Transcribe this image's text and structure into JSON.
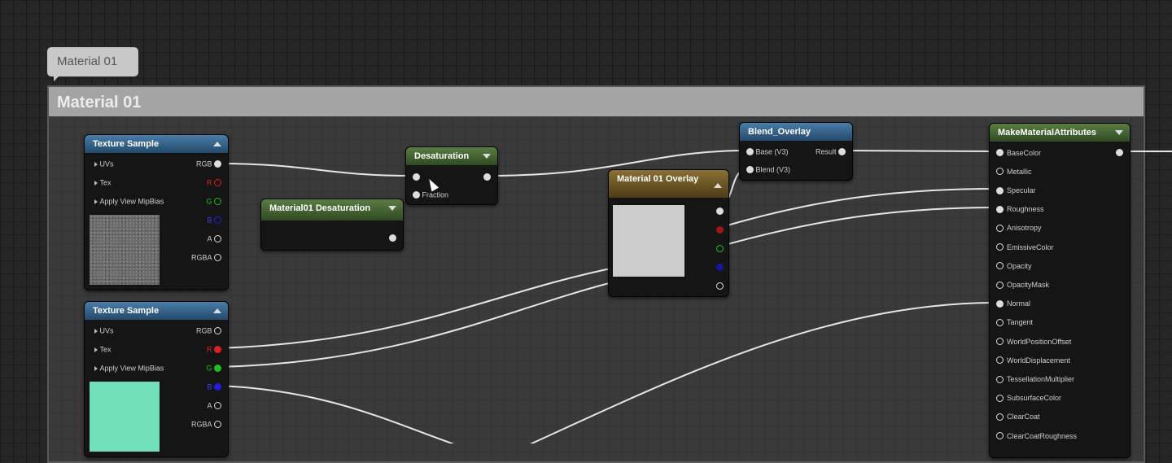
{
  "tooltip": {
    "text": "Material 01"
  },
  "comment": {
    "title": "Material 01"
  },
  "nodes": {
    "tex1": {
      "title": "Texture Sample",
      "inputs": [
        "UVs",
        "Tex",
        "Apply View MipBias"
      ],
      "outputs": [
        "RGB",
        "R",
        "G",
        "B",
        "A",
        "RGBA"
      ]
    },
    "tex2": {
      "title": "Texture Sample",
      "inputs": [
        "UVs",
        "Tex",
        "Apply View MipBias"
      ],
      "outputs": [
        "RGB",
        "R",
        "G",
        "B",
        "A",
        "RGBA"
      ]
    },
    "mat_desat": {
      "title": "Material01 Desaturation"
    },
    "desat": {
      "title": "Desaturation",
      "inputs": [
        "",
        "Fraction"
      ]
    },
    "overlay": {
      "title": "Material 01 Overlay"
    },
    "blend": {
      "title": "Blend_Overlay",
      "inputs": [
        "Base (V3)",
        "Blend (V3)"
      ],
      "output": "Result"
    },
    "mma": {
      "title": "MakeMaterialAttributes",
      "inputs": [
        "BaseColor",
        "Metallic",
        "Specular",
        "Roughness",
        "Anisotropy",
        "EmissiveColor",
        "Opacity",
        "OpacityMask",
        "Normal",
        "Tangent",
        "WorldPositionOffset",
        "WorldDisplacement",
        "TessellationMultiplier",
        "SubsurfaceColor",
        "ClearCoat",
        "ClearCoatRoughness"
      ]
    }
  },
  "colors": {
    "r_pin": "#e02020",
    "g_pin": "#20c020",
    "b_pin": "#2020e0",
    "tex2_preview": "#6fe0b8",
    "overlay_preview": "#cccccc"
  }
}
